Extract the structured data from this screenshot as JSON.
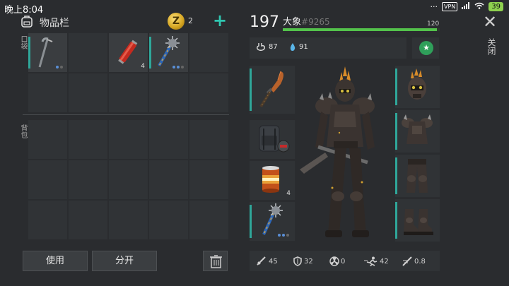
{
  "status_bar": {
    "time": "晚上8:04",
    "vpn": "VPN",
    "battery": "39"
  },
  "inventory": {
    "title": "物品栏",
    "coin_symbol": "Z",
    "coin_count": "2",
    "add_label": "+",
    "pocket_label": "口袋",
    "backpack_label": "背包",
    "pocket_slots": [
      {
        "item": "crowbar-icon",
        "qty": "",
        "durability": true
      },
      {
        "item": "",
        "qty": ""
      },
      {
        "item": "dynamite-icon",
        "qty": "4"
      },
      {
        "item": "spiked-mace-icon",
        "qty": "",
        "durability": true
      },
      {
        "item": "",
        "qty": ""
      },
      {
        "item": "",
        "qty": ""
      },
      {
        "item": "",
        "qty": ""
      },
      {
        "item": "",
        "qty": ""
      },
      {
        "item": "",
        "qty": ""
      },
      {
        "item": "",
        "qty": ""
      }
    ],
    "use_button": "使用",
    "split_button": "分开"
  },
  "character": {
    "level": "197",
    "name": "大象",
    "id": "#9265",
    "xp_max": "120",
    "xp_fraction": 0.98,
    "hunger": "87",
    "thirst": "91",
    "weapon_slot_qty": "",
    "food_qty": "4",
    "stats": {
      "attack": "45",
      "defense": "32",
      "radiation": "0",
      "speed": "42",
      "bleed": "0.8"
    }
  },
  "close_label": "关闭",
  "close_symbol": "✕",
  "colors": {
    "accent": "#2fa79a",
    "xp": "#53c24b",
    "coin": "#d2a21e"
  }
}
